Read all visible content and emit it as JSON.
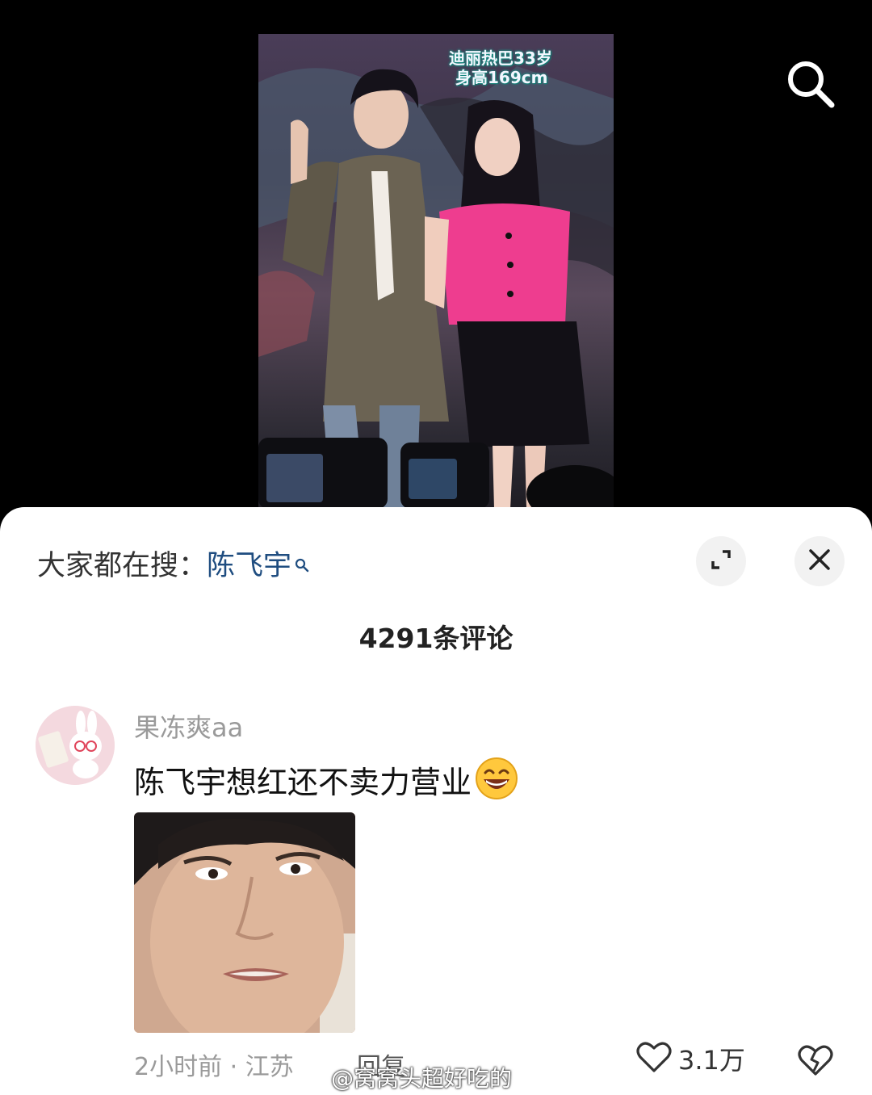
{
  "video": {
    "overlay_lines": [
      "迪丽热巴33岁",
      "身高169cm"
    ],
    "search_icon": "search-icon"
  },
  "comments_panel": {
    "hot_search_prefix": "大家都在搜：",
    "hot_search_term": "陈飞宇",
    "comment_count": "4291条评论",
    "expand_icon": "expand-icon",
    "close_icon": "close-icon"
  },
  "comment": {
    "username": "果冻爽aa",
    "text": "陈飞宇想红还不卖力营业",
    "emoji": "grinning-face",
    "meta": "2小时前 · 江苏",
    "reply_label": "回复",
    "like_count": "3.1万"
  },
  "watermark": "@窝窝头超好吃的"
}
